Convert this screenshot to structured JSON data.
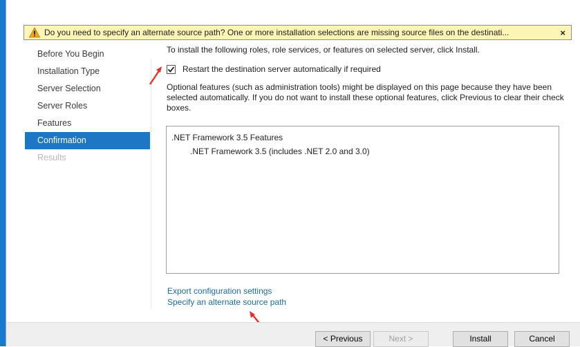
{
  "warning": {
    "text": "Do you need to specify an alternate source path? One or more installation selections are missing source files on the destinati...",
    "close": "×"
  },
  "nav": {
    "items": [
      {
        "label": "Before You Begin"
      },
      {
        "label": "Installation Type"
      },
      {
        "label": "Server Selection"
      },
      {
        "label": "Server Roles"
      },
      {
        "label": "Features"
      },
      {
        "label": "Confirmation",
        "state": "active"
      },
      {
        "label": "Results",
        "state": "disabled"
      }
    ]
  },
  "content": {
    "intro": "To install the following roles, role services, or features on selected server, click Install.",
    "restart_label": "Restart the destination server automatically if required",
    "restart_checked": true,
    "optional_text": "Optional features (such as administration tools) might be displayed on this page because they have been selected automatically. If you do not want to install these optional features, click Previous to clear their check boxes.",
    "features": [
      ".NET Framework 3.5 Features",
      ".NET Framework 3.5 (includes .NET 2.0 and 3.0)"
    ],
    "export_link": "Export configuration settings",
    "alt_source_link": "Specify an alternate source path"
  },
  "buttons": {
    "previous": "< Previous",
    "next": "Next >",
    "install": "Install",
    "cancel": "Cancel"
  },
  "colors": {
    "accent": "#1e77c5",
    "warning_bg": "#fdf5b6",
    "link": "#1a6aa8",
    "annotation_arrow": "#e8302b"
  }
}
